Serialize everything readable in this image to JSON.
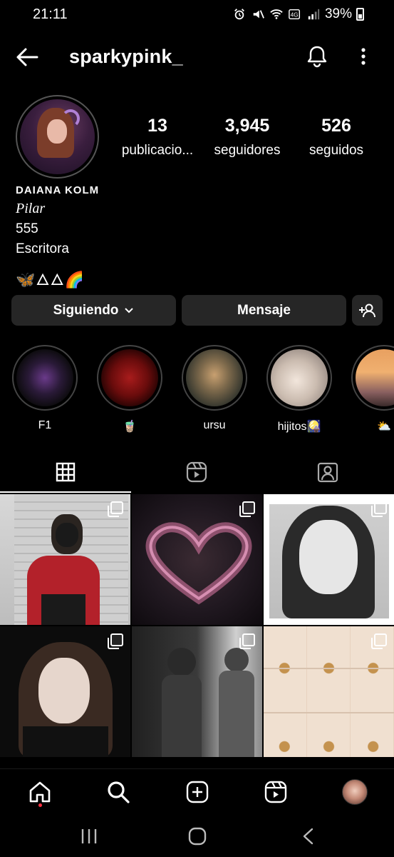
{
  "status_bar": {
    "time": "21:11",
    "battery": "39%",
    "icons": [
      "alarm-icon",
      "mute-icon",
      "wifi-icon",
      "volte-icon",
      "signal-icon",
      "battery-icon"
    ]
  },
  "header": {
    "username": "sparkypink_",
    "icons": [
      "back-arrow-icon",
      "bell-icon",
      "more-vertical-icon"
    ]
  },
  "profile": {
    "stats": [
      {
        "value": "13",
        "label": "publicacio..."
      },
      {
        "value": "3,945",
        "label": "seguidores"
      },
      {
        "value": "526",
        "label": "seguidos"
      }
    ],
    "name": "DAIANA KOLM",
    "category": "Pilar",
    "bio_lines": [
      "555",
      "Escritora"
    ],
    "bio_emojis": "🦋🜂🜂🌈"
  },
  "actions": {
    "following_label": "Siguiendo",
    "message_label": "Mensaje",
    "suggest_icon": "add-person-icon"
  },
  "highlights": [
    {
      "label": "F1"
    },
    {
      "label": "🧋"
    },
    {
      "label": "ursu"
    },
    {
      "label": "hijitos🎑"
    },
    {
      "label": "⛅"
    }
  ],
  "tabs": [
    {
      "name": "grid",
      "icon": "grid-icon",
      "active": true
    },
    {
      "name": "reels",
      "icon": "reels-icon",
      "active": false
    },
    {
      "name": "tagged",
      "icon": "tagged-person-icon",
      "active": false
    }
  ],
  "grid_posts": [
    {
      "multi": true
    },
    {
      "multi": true
    },
    {
      "multi": true
    },
    {
      "multi": true
    },
    {
      "multi": true
    },
    {
      "multi": true
    }
  ],
  "bottom_nav": [
    "home-icon",
    "search-icon",
    "create-icon",
    "reels-icon",
    "profile-avatar"
  ],
  "colors": {
    "background": "#000000",
    "button": "#262626",
    "notification_dot": "#ff3040"
  }
}
